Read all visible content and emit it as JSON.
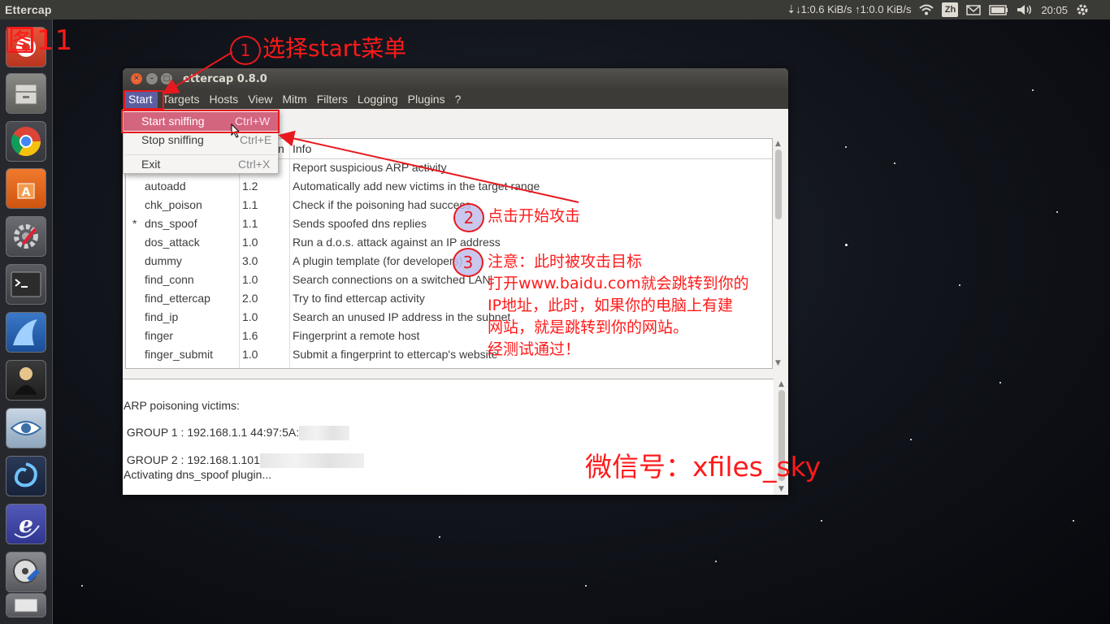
{
  "top_panel": {
    "app_name": "Ettercap",
    "network_speed": "⇣↓1:0.6 KiB/s ↑1:0.0 KiB/s",
    "input_method": "Zh",
    "clock": "20:05",
    "icons": [
      "updown-arrows-icon",
      "wifi-icon",
      "input-method-icon",
      "mail-icon",
      "battery-icon",
      "volume-icon",
      "gear-icon"
    ]
  },
  "launcher": {
    "items": [
      "home-folder-icon",
      "files-icon",
      "chrome-icon",
      "software-center-icon",
      "system-settings-icon",
      "terminal-icon",
      "wireshark-icon",
      "hacker-app-icon",
      "eye-app-icon",
      "blue-swirl-icon",
      "ettercap-icon",
      "media-converter-icon",
      "trash-icon"
    ]
  },
  "window": {
    "title": "ettercap 0.8.0",
    "menus": [
      "Start",
      "Targets",
      "Hosts",
      "View",
      "Mitm",
      "Filters",
      "Logging",
      "Plugins",
      "?"
    ],
    "start_menu": {
      "items": [
        {
          "label": "Start sniffing",
          "accel": "Ctrl+W"
        },
        {
          "label": "Stop sniffing",
          "accel": "Ctrl+E"
        },
        {
          "label": "Exit",
          "accel": "Ctrl+X"
        }
      ]
    },
    "plugins_table": {
      "headers": {
        "version_partial": "n",
        "info": "Info"
      },
      "rows": [
        {
          "mark": "",
          "name": "",
          "version": "",
          "info": "Report suspicious ARP activity"
        },
        {
          "mark": "",
          "name": "autoadd",
          "version": "1.2",
          "info": "Automatically add new victims in the target range"
        },
        {
          "mark": "",
          "name": "chk_poison",
          "version": "1.1",
          "info": "Check if the poisoning had success"
        },
        {
          "mark": "*",
          "name": "dns_spoof",
          "version": "1.1",
          "info": "Sends spoofed dns replies"
        },
        {
          "mark": "",
          "name": "dos_attack",
          "version": "1.0",
          "info": "Run a d.o.s. attack against an IP address"
        },
        {
          "mark": "",
          "name": "dummy",
          "version": "3.0",
          "info": "A plugin template (for developers)"
        },
        {
          "mark": "",
          "name": "find_conn",
          "version": "1.0",
          "info": "Search connections on a switched LAN"
        },
        {
          "mark": "",
          "name": "find_ettercap",
          "version": "2.0",
          "info": "Try to find ettercap activity"
        },
        {
          "mark": "",
          "name": "find_ip",
          "version": "1.0",
          "info": "Search an unused IP address in the subnet"
        },
        {
          "mark": "",
          "name": "finger",
          "version": "1.6",
          "info": "Fingerprint a remote host"
        },
        {
          "mark": "",
          "name": "finger_submit",
          "version": "1.0",
          "info": "Submit a fingerprint to ettercap's website"
        }
      ]
    },
    "log": {
      "lines": [
        "ARP poisoning victims:",
        " GROUP 1 : 192.168.1.1 44:97:5A:",
        " GROUP 2 : 192.168.1.101",
        "Activating dns_spoof plugin..."
      ]
    }
  },
  "annotations": {
    "figure_label": "图11",
    "step1_num": "1",
    "step1_text": "选择start菜单",
    "step2_num": "2",
    "step2_text": "点击开始攻击",
    "step3_num": "3",
    "step3_lines": [
      "注意：此时被攻击目标",
      "打开www.baidu.com就会跳转到你的",
      "IP地址，此时，如果你的电脑上有建",
      "网站，就是跳转到你的网站。",
      "经测试通过！"
    ],
    "wechat": "微信号：xfiles_sky",
    "accent_color": "#e8191e"
  }
}
